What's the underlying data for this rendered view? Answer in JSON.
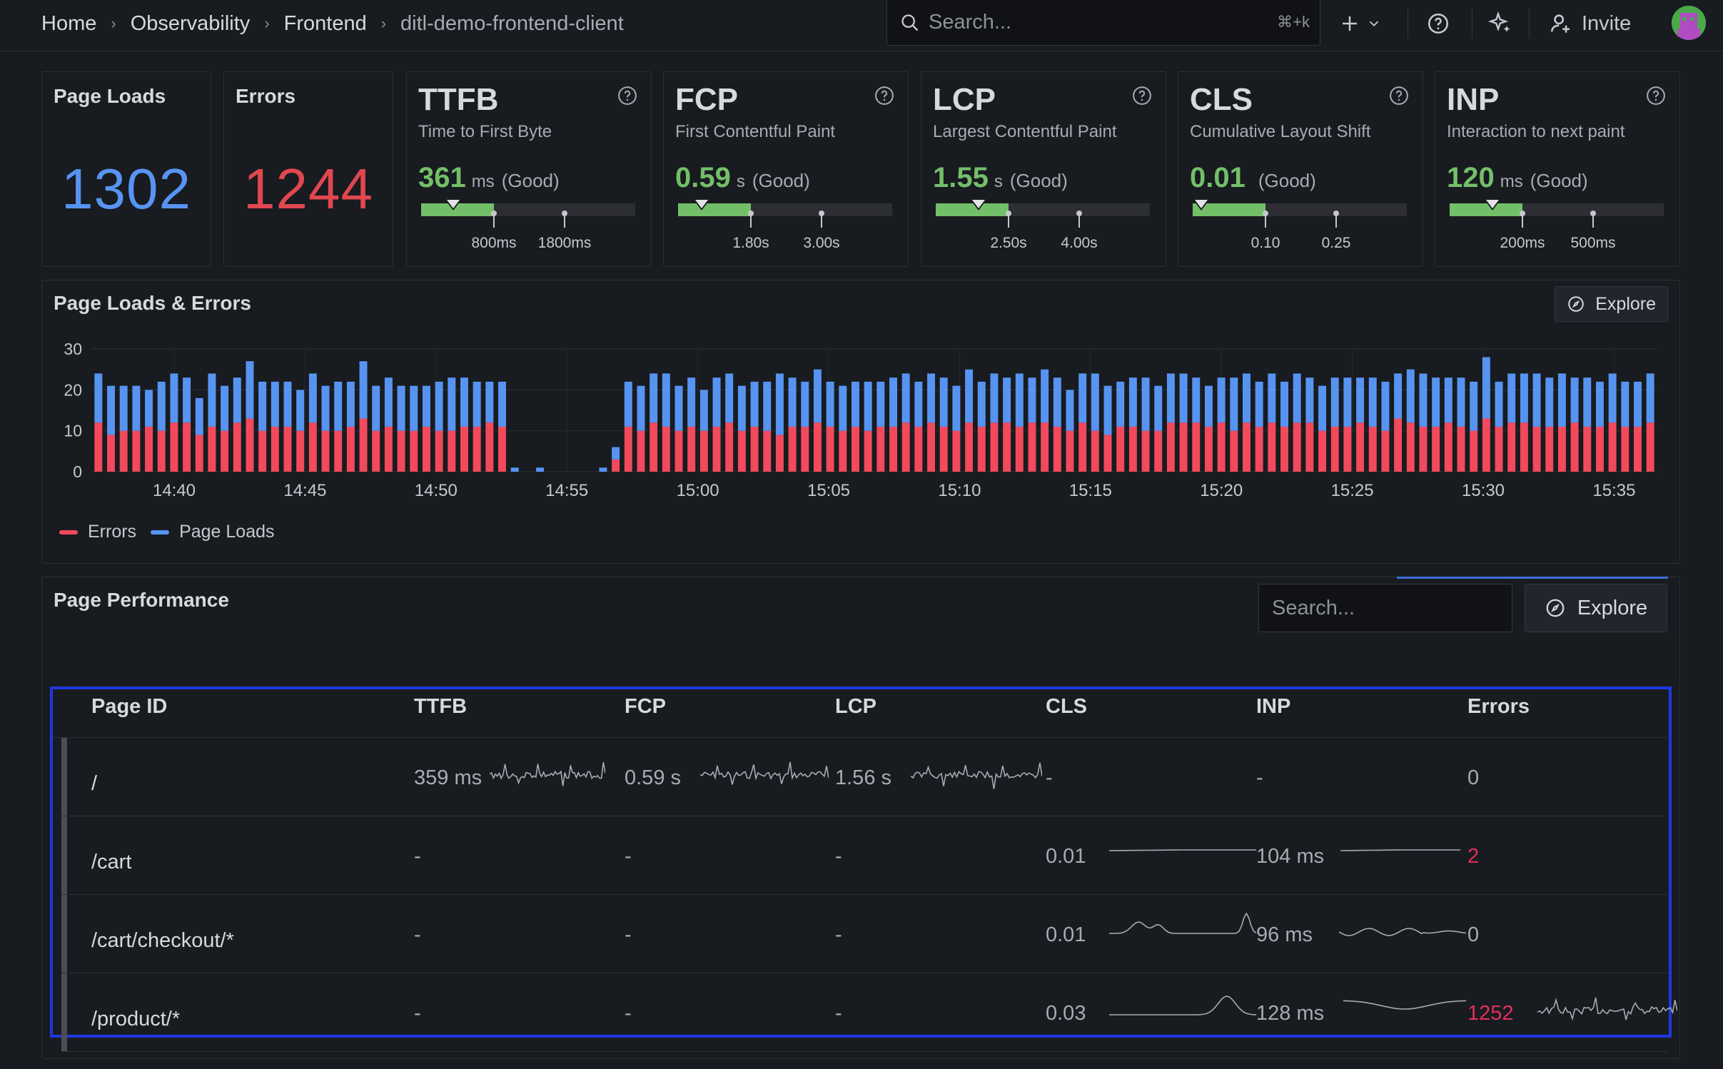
{
  "breadcrumbs": [
    "Home",
    "Observability",
    "Frontend",
    "ditl-demo-frontend-client"
  ],
  "topbar": {
    "search_placeholder": "Search...",
    "search_shortcut": "⌘+k",
    "invite_label": "Invite"
  },
  "stats": [
    {
      "title": "Page Loads",
      "value": "1302",
      "color": "#5794f2"
    },
    {
      "title": "Errors",
      "value": "1244",
      "color": "#e0474f"
    }
  ],
  "vitals": [
    {
      "abbr": "TTFB",
      "name": "Time to First Byte",
      "value": "361",
      "unit": "ms",
      "rating": "(Good)",
      "position": 0.15,
      "good_fill": 0.34,
      "thresholds": [
        "800ms",
        "1800ms"
      ]
    },
    {
      "abbr": "FCP",
      "name": "First Contentful Paint",
      "value": "0.59",
      "unit": "s",
      "rating": "(Good)",
      "position": 0.11,
      "good_fill": 0.34,
      "thresholds": [
        "1.80s",
        "3.00s"
      ]
    },
    {
      "abbr": "LCP",
      "name": "Largest Contentful Paint",
      "value": "1.55",
      "unit": "s",
      "rating": "(Good)",
      "position": 0.2,
      "good_fill": 0.34,
      "thresholds": [
        "2.50s",
        "4.00s"
      ]
    },
    {
      "abbr": "CLS",
      "name": "Cumulative Layout Shift",
      "value": "0.01",
      "unit": "",
      "rating": "(Good)",
      "position": 0.04,
      "good_fill": 0.34,
      "thresholds": [
        "0.10",
        "0.25"
      ]
    },
    {
      "abbr": "INP",
      "name": "Interaction to next paint",
      "value": "120",
      "unit": "ms",
      "rating": "(Good)",
      "position": 0.2,
      "good_fill": 0.34,
      "thresholds": [
        "200ms",
        "500ms"
      ]
    }
  ],
  "chart_panel": {
    "title": "Page Loads & Errors",
    "explore_label": "Explore",
    "legend": [
      {
        "name": "Errors",
        "color": "#f2495c"
      },
      {
        "name": "Page Loads",
        "color": "#5794f2"
      }
    ]
  },
  "chart_data": {
    "type": "bar",
    "stacked": true,
    "ylim": [
      0,
      30
    ],
    "yticks": [
      "0",
      "10",
      "20",
      "30"
    ],
    "xticks": [
      "14:40",
      "14:45",
      "14:50",
      "14:55",
      "15:00",
      "15:05",
      "15:10",
      "15:15",
      "15:20",
      "15:25",
      "15:30",
      "15:35"
    ],
    "series": [
      {
        "name": "Errors",
        "color": "#f2495c",
        "values": [
          12,
          9,
          10,
          10,
          11,
          10,
          12,
          12,
          9,
          11,
          10,
          12,
          13,
          10,
          11,
          11,
          10,
          12,
          10,
          10,
          11,
          13,
          10,
          11,
          10,
          10,
          11,
          10,
          10,
          11,
          11,
          12,
          11,
          0,
          0,
          0,
          0,
          0,
          0,
          0,
          0,
          3,
          11,
          10,
          12,
          11,
          10,
          11,
          10,
          11,
          12,
          10,
          11,
          10,
          9,
          11,
          11,
          12,
          11,
          10,
          11,
          10,
          11,
          11,
          12,
          11,
          12,
          11,
          10,
          12,
          11,
          12,
          12,
          11,
          12,
          12,
          11,
          10,
          12,
          10,
          9,
          11,
          11,
          10,
          10,
          12,
          12,
          12,
          11,
          12,
          10,
          12,
          11,
          12,
          11,
          12,
          12,
          10,
          11,
          11,
          12,
          11,
          10,
          13,
          12,
          11,
          11,
          12,
          11,
          10,
          13,
          11,
          12,
          12,
          11,
          11,
          11,
          12,
          11,
          11,
          12,
          11,
          11,
          12
        ]
      },
      {
        "name": "Page Loads",
        "color": "#5794f2",
        "values": [
          12,
          12,
          11,
          11,
          9,
          12,
          12,
          11,
          9,
          13,
          11,
          11,
          14,
          12,
          11,
          11,
          10,
          12,
          11,
          12,
          11,
          14,
          11,
          12,
          11,
          11,
          10,
          12,
          13,
          12,
          11,
          10,
          11,
          1,
          0,
          1,
          0,
          0,
          0,
          0,
          1,
          3,
          11,
          11,
          12,
          13,
          11,
          12,
          10,
          12,
          12,
          11,
          11,
          12,
          15,
          12,
          11,
          13,
          11,
          11,
          11,
          12,
          11,
          12,
          12,
          11,
          12,
          12,
          11,
          13,
          11,
          12,
          11,
          13,
          11,
          13,
          12,
          10,
          12,
          14,
          12,
          11,
          12,
          13,
          11,
          12,
          12,
          11,
          10,
          11,
          13,
          12,
          11,
          12,
          11,
          12,
          11,
          11,
          12,
          12,
          11,
          12,
          12,
          11,
          13,
          13,
          12,
          11,
          12,
          12,
          15,
          11,
          12,
          12,
          13,
          12,
          13,
          11,
          12,
          11,
          12,
          11,
          11,
          12
        ]
      }
    ]
  },
  "table_panel": {
    "title": "Page Performance",
    "search_placeholder": "Search...",
    "explore_label": "Explore",
    "columns": [
      "Page ID",
      "TTFB",
      "FCP",
      "LCP",
      "CLS",
      "INP",
      "Errors"
    ],
    "rows": [
      {
        "page": "/",
        "ttfb": "359 ms",
        "fcp": "0.59 s",
        "lcp": "1.56 s",
        "cls": "-",
        "inp": "-",
        "errors": "0",
        "errors_alert": false
      },
      {
        "page": "/cart",
        "ttfb": "-",
        "fcp": "-",
        "lcp": "-",
        "cls": "0.01",
        "inp": "104 ms",
        "errors": "2",
        "errors_alert": true
      },
      {
        "page": "/cart/checkout/*",
        "ttfb": "-",
        "fcp": "-",
        "lcp": "-",
        "cls": "0.01",
        "inp": "96 ms",
        "errors": "0",
        "errors_alert": false
      },
      {
        "page": "/product/*",
        "ttfb": "-",
        "fcp": "-",
        "lcp": "-",
        "cls": "0.03",
        "inp": "128 ms",
        "errors": "1252",
        "errors_alert": true
      }
    ]
  }
}
